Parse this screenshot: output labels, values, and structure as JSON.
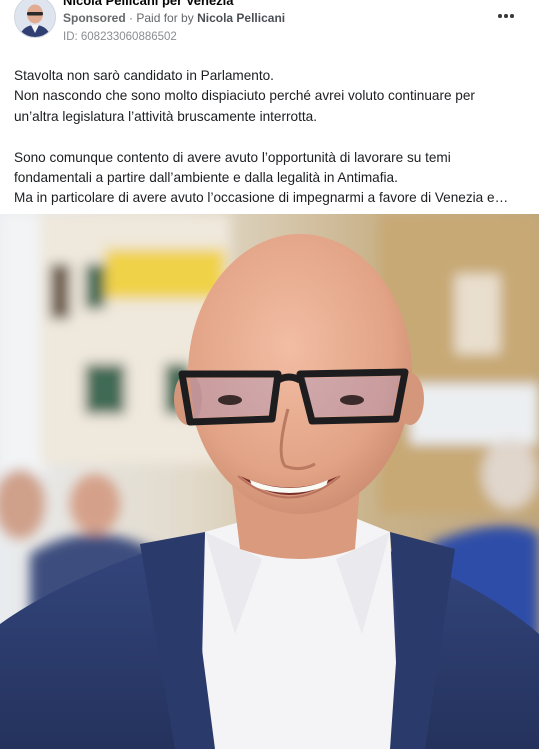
{
  "post": {
    "page_name": "Nicola Pellicani per Venezia",
    "sponsored_label": "Sponsored",
    "paid_for_prefix": "Paid for by",
    "paid_for_name": "Nicola Pellicani",
    "ad_id": "ID: 608233060886502",
    "more_icon": "more-horizontal-icon",
    "text_lines": [
      "Stavolta non sarò candidato in Parlamento.",
      "Non nascondo che sono molto dispiaciuto perché avrei voluto continuare per",
      "un’altra legislatura l’attività bruscamente interrotta.",
      "Sono comunque contento di avere avuto l’opportunità di lavorare su temi",
      "fondamentali a partire dall’ambiente e dalla legalità in Antimafia.",
      "Ma in particolare di avere avuto l’occasione di impegnarmi a favore di Venezia e…"
    ]
  },
  "colors": {
    "suit": "#2f3f73",
    "shirt": "#f4f4f6",
    "skin": "#e6a98f",
    "background_wall": "#e6dccb"
  }
}
